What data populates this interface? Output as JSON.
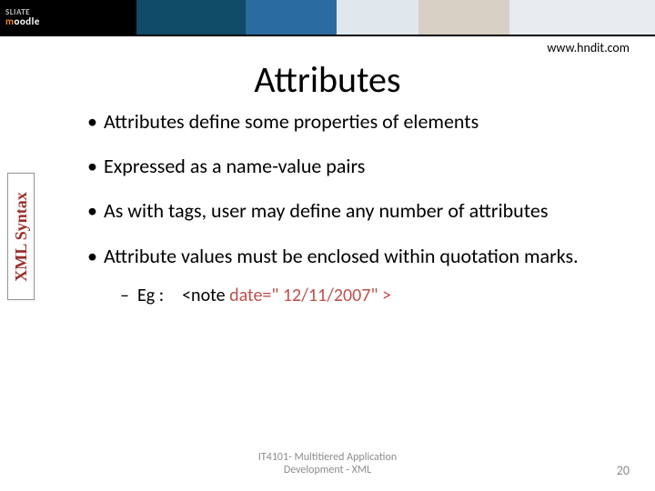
{
  "banner": {
    "top_text": "SLIATE",
    "brand_html": "moodle"
  },
  "header": {
    "url": "www.hndit.com",
    "title": "Attributes"
  },
  "sidebar": {
    "label": "XML Syntax"
  },
  "bullets": [
    {
      "text": "Attributes define some properties of elements"
    },
    {
      "text": "Expressed as a name-value pairs"
    },
    {
      "text": "As with tags, user may define any number of attributes",
      "justify": true
    },
    {
      "text": "Attribute values must be enclosed within quotation marks.",
      "justify": true
    }
  ],
  "example": {
    "label": "Eg :",
    "code_plain_prefix": "<note ",
    "code_highlight": "date=\" 12/11/2007\"  >"
  },
  "footer": {
    "line1": "IT4101- Multitiered Application",
    "line2": "Development - XML",
    "page": "20"
  }
}
